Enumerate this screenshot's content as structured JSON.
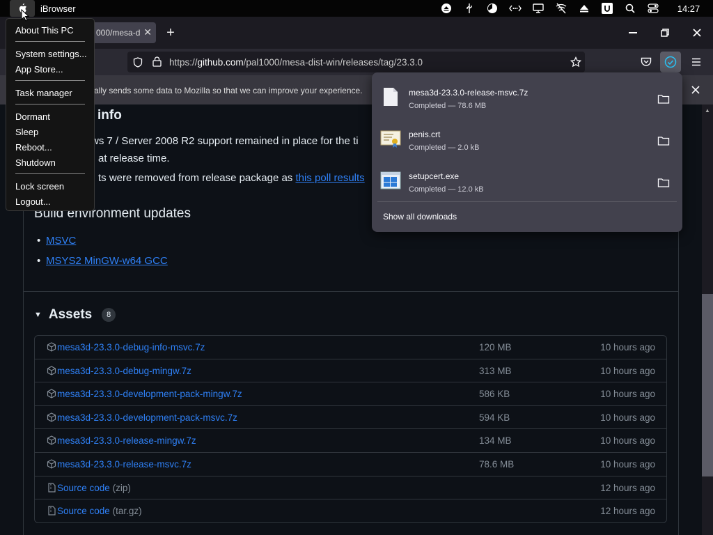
{
  "menubar": {
    "app_name": "iBrowser",
    "clock": "14:27",
    "icons": [
      "eject-icon",
      "usb-icon",
      "pie-chart-icon",
      "network-icon",
      "display-icon",
      "no-wifi-icon",
      "upload-icon",
      "u-badge-icon",
      "search-icon",
      "toggle-icon"
    ]
  },
  "apple_menu": {
    "items": [
      "About This PC",
      "System settings...",
      "App Store...",
      "Task manager",
      "Dormant",
      "Sleep",
      "Reboot...",
      "Shutdown",
      "Lock screen",
      "Logout..."
    ]
  },
  "browser": {
    "tab_title": "000/mesa-d",
    "url_prefix": "https://",
    "url_host": "github.com",
    "url_path": "/pal1000/mesa-dist-win/releases/tag/23.3.0",
    "notice_text": "ally sends some data to Mozilla so that we can improve your experience."
  },
  "downloads": {
    "items": [
      {
        "name": "mesa3d-23.3.0-release-msvc.7z",
        "status": "Completed — 78.6 MB",
        "icon": "file-icon"
      },
      {
        "name": "penis.crt",
        "status": "Completed — 2.0 kB",
        "icon": "certificate-icon"
      },
      {
        "name": "setupcert.exe",
        "status": "Completed — 12.0 kB",
        "icon": "exe-icon"
      }
    ],
    "show_all": "Show all downloads"
  },
  "content": {
    "info_heading": "info",
    "line1": "ws 7 / Server 2008 R2 support remained in place for the ti",
    "line2": "at release time.",
    "line3": "ts were removed from release package as",
    "line3_link": "this poll results",
    "build_heading": "Build environment updates",
    "bullets": [
      "MSVC",
      "MSYS2 MinGW-w64 GCC"
    ],
    "assets_heading": "Assets",
    "assets_count": "8",
    "assets": [
      {
        "name": "mesa3d-23.3.0-debug-info-msvc.7z",
        "size": "120 MB",
        "time": "10 hours ago"
      },
      {
        "name": "mesa3d-23.3.0-debug-mingw.7z",
        "size": "313 MB",
        "time": "10 hours ago"
      },
      {
        "name": "mesa3d-23.3.0-development-pack-mingw.7z",
        "size": "586 KB",
        "time": "10 hours ago"
      },
      {
        "name": "mesa3d-23.3.0-development-pack-msvc.7z",
        "size": "594 KB",
        "time": "10 hours ago"
      },
      {
        "name": "mesa3d-23.3.0-release-mingw.7z",
        "size": "134 MB",
        "time": "10 hours ago"
      },
      {
        "name": "mesa3d-23.3.0-release-msvc.7z",
        "size": "78.6 MB",
        "time": "10 hours ago"
      },
      {
        "name": "Source code",
        "suffix": "(zip)",
        "size": "",
        "time": "12 hours ago"
      },
      {
        "name": "Source code",
        "suffix": "(tar.gz)",
        "size": "",
        "time": "12 hours ago"
      }
    ]
  }
}
